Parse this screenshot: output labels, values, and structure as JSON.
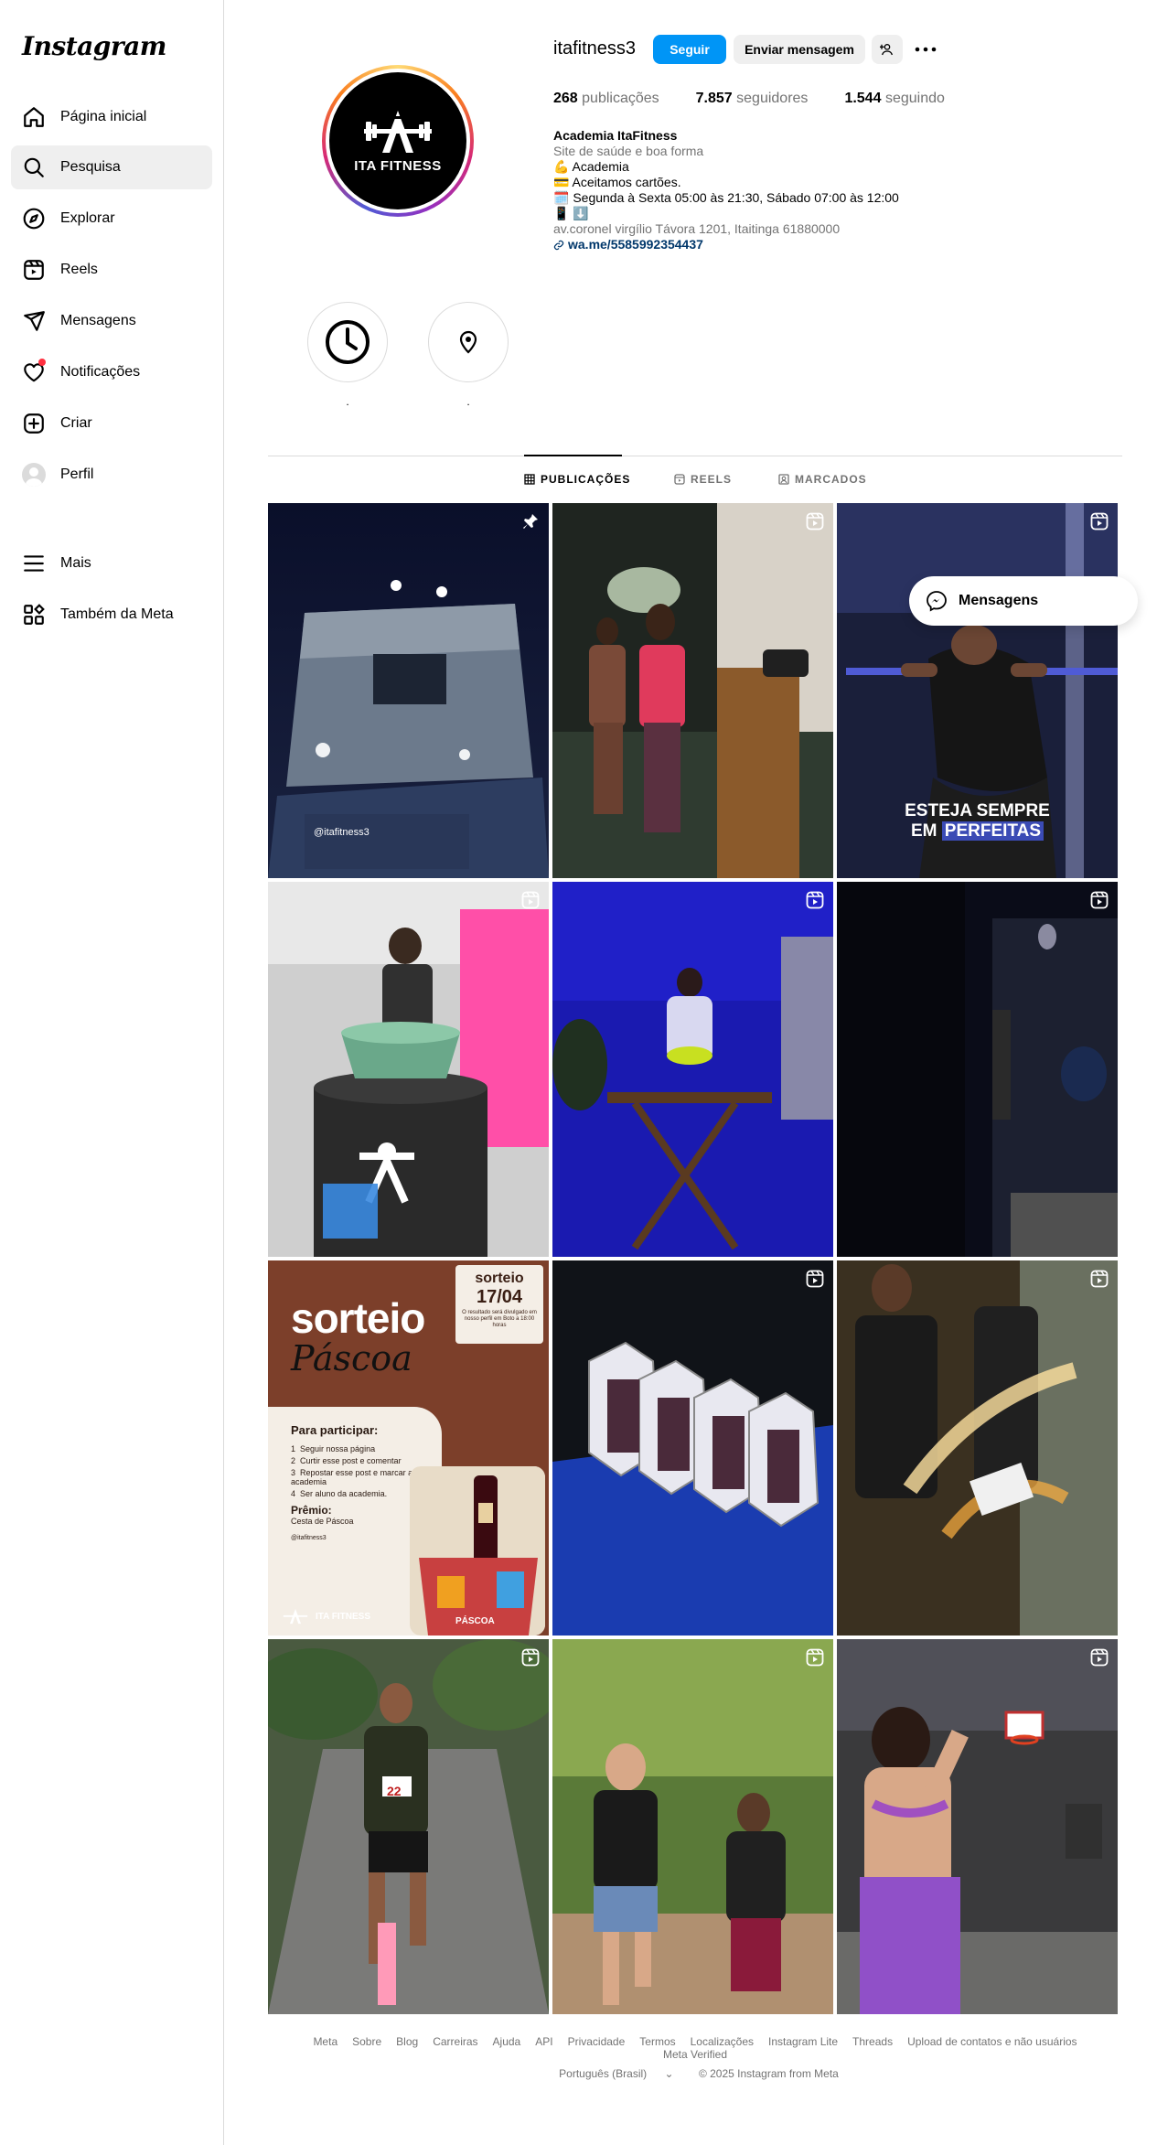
{
  "app": {
    "logo_text": "Instagram"
  },
  "sidebar": {
    "items": [
      {
        "label": "Página inicial",
        "icon": "home-icon"
      },
      {
        "label": "Pesquisa",
        "icon": "search-icon"
      },
      {
        "label": "Explorar",
        "icon": "compass-icon"
      },
      {
        "label": "Reels",
        "icon": "reels-icon"
      },
      {
        "label": "Mensagens",
        "icon": "send-icon"
      },
      {
        "label": "Notificações",
        "icon": "heart-icon"
      },
      {
        "label": "Criar",
        "icon": "plus-square-icon"
      },
      {
        "label": "Perfil",
        "icon": "avatar-icon"
      },
      {
        "label": "Mais",
        "icon": "menu-icon"
      },
      {
        "label": "Também da Meta",
        "icon": "meta-apps-icon"
      }
    ]
  },
  "profile": {
    "username": "itafitness3",
    "follow_label": "Seguir",
    "message_label": "Enviar mensagem",
    "picture_text": "ITA FITNESS",
    "stats": {
      "posts_count": "268",
      "posts_label": "publicações",
      "followers_count": "7.857",
      "followers_label": "seguidores",
      "following_count": "1.544",
      "following_label": "seguindo"
    },
    "bio": {
      "name": "Academia ItaFitness",
      "category": "Site de saúde e boa forma",
      "line1": "💪 Academia",
      "line2": "💳 Aceitamos cartões.",
      "line3": "🗓️ Segunda à Sexta 05:00 às 21:30, Sábado 07:00 às 12:00",
      "line4": "📱 ⬇️",
      "address": "av.coronel virgílio Távora 1201, Itaitinga 61880000",
      "link": "wa.me/5585992354437"
    },
    "highlights": [
      {
        "label": ".",
        "icon": "clock-icon"
      },
      {
        "label": ".",
        "icon": "location-pin-icon"
      }
    ]
  },
  "tabs": [
    {
      "label": "PUBLICAÇÕES",
      "icon": "grid-icon"
    },
    {
      "label": "REELS",
      "icon": "reels-small-icon"
    },
    {
      "label": "MARCADOS",
      "icon": "tagged-icon"
    }
  ],
  "posts": {
    "p1_caption": "@itafitness3",
    "p3_caption_line1": "ESTEJA SEMPRE",
    "p3_caption_line2a": "EM ",
    "p3_caption_line2b": "PERFEITAS",
    "p7": {
      "title": "sorteio",
      "subtitle": "Páscoa",
      "date_label": "sorteio",
      "date": "17/04",
      "date_note": "O resultado será divulgado em nosso perfil em Boto a 18:00 horas",
      "participate": "Para participar:",
      "step1": "Seguir nossa página",
      "step2": "Curtir esse post e comentar",
      "step3": "Repostar esse post e marcar a academia",
      "step4": "Ser aluno da academia.",
      "prize_title": "Prêmio:",
      "prize": "Cesta de Páscoa",
      "handle": "@itafitness3",
      "brand": "ITA FITNESS",
      "basket_label": "PÁSCOA"
    },
    "p10_bib": "22"
  },
  "messages_float": {
    "label": "Mensagens"
  },
  "footer": {
    "links": [
      "Meta",
      "Sobre",
      "Blog",
      "Carreiras",
      "Ajuda",
      "API",
      "Privacidade",
      "Termos",
      "Localizações",
      "Instagram Lite",
      "Threads",
      "Upload de contatos e não usuários",
      "Meta Verified"
    ],
    "language": "Português (Brasil)",
    "copyright": "© 2025 Instagram from Meta"
  },
  "colors": {
    "accent": "#0095f6",
    "text_secondary": "#737373",
    "border": "#dbdbdb",
    "notification": "#ff3040"
  }
}
